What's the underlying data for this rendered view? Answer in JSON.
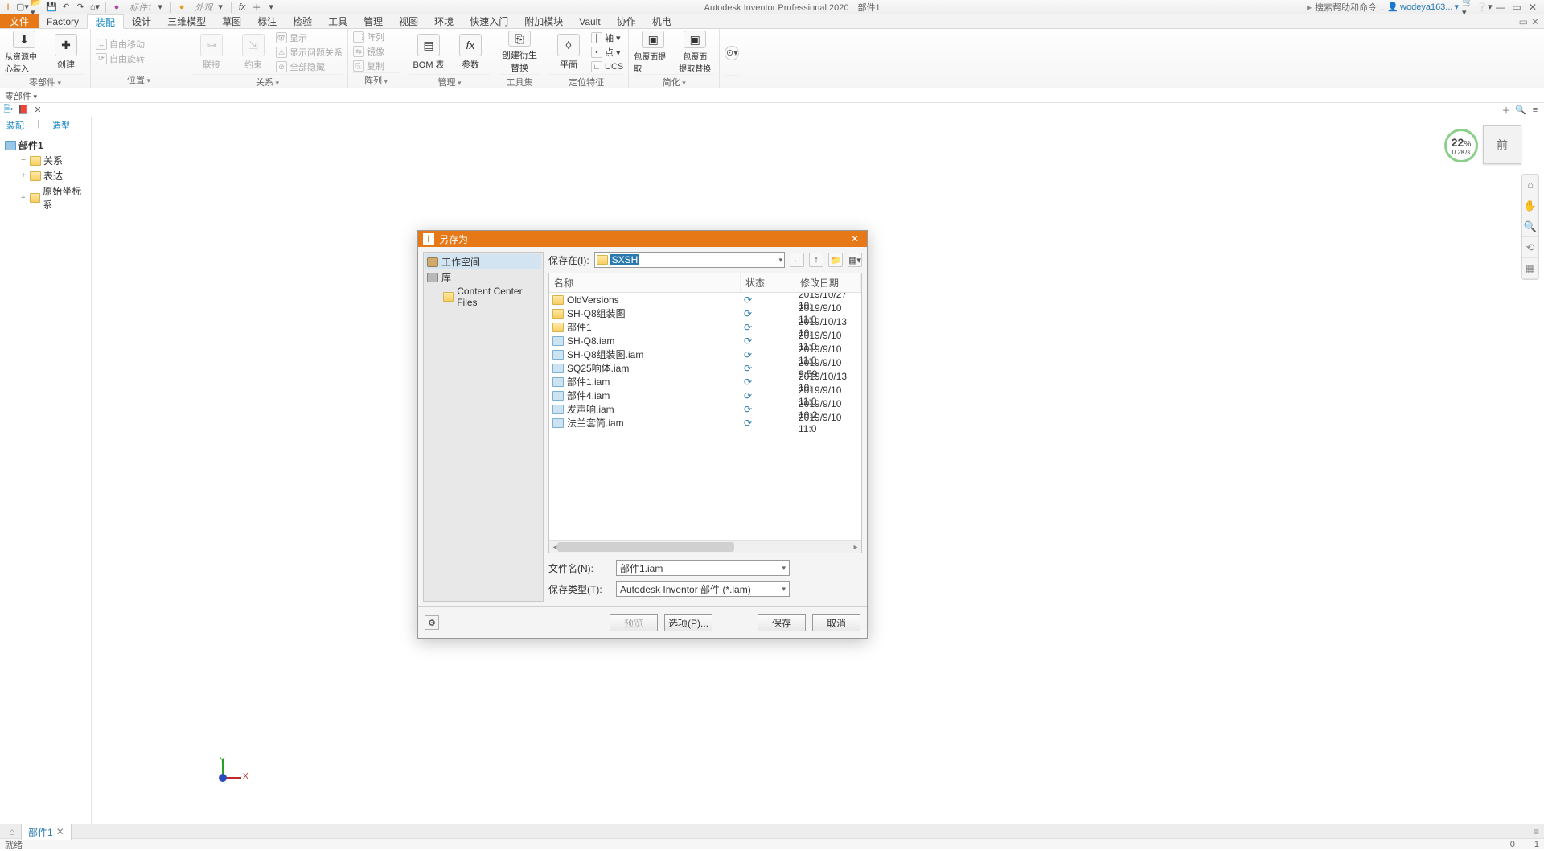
{
  "app": {
    "title_full": "Autodesk Inventor Professional 2020　部件1",
    "doc": "部件1"
  },
  "qat": {
    "search1": "标件1",
    "search2": "外观",
    "help_search": "搜索帮助和命令...",
    "user": "wodeya163..."
  },
  "tabs": {
    "file": "文件",
    "items": [
      "Factory",
      "装配",
      "设计",
      "三维模型",
      "草图",
      "标注",
      "检验",
      "工具",
      "管理",
      "视图",
      "环境",
      "快速入门",
      "附加模块",
      "Vault",
      "协作",
      "机电"
    ],
    "active_index": 1
  },
  "ribbon": {
    "panel1": {
      "btn1": "从资源中心装入",
      "btn2": "创建",
      "title": "零部件"
    },
    "panel2": {
      "row1": "自由移动",
      "row2": "自由旋转",
      "col2a": "联接",
      "col2b": "约束",
      "col3a": "显示",
      "col3b": "显示问题关系",
      "col3c": "全部隐藏",
      "title": "位置",
      "title2": "关系"
    },
    "panel3": {
      "r1": "阵列",
      "r2": "镜像",
      "r3": "复制",
      "title": "阵列"
    },
    "panel4": {
      "b1": "BOM 表",
      "b2": "参数",
      "title": "管理"
    },
    "panel5": {
      "b1": "创建衍生\n替换",
      "title": "工具集"
    },
    "panel6": {
      "b1": "平面",
      "r1": "轴",
      "r2": "点",
      "r3": "UCS",
      "title": "定位特征"
    },
    "panel7": {
      "b1": "包覆面提取",
      "b2": "包覆面\n提取替换",
      "title": "简化"
    }
  },
  "quick_panel": {
    "title": "零部件"
  },
  "browser": {
    "tabs": [
      "装配",
      "造型"
    ],
    "root": "部件1",
    "children": [
      "关系",
      "表达",
      "原始坐标系"
    ]
  },
  "viewcube": {
    "face": "前"
  },
  "ring": {
    "pct": "22",
    "unit": "%",
    "rate": "0.2K/s"
  },
  "nav_icons": [
    "⌂",
    "✋",
    "🔍",
    "⟲",
    "▦"
  ],
  "triad": {
    "x": "X",
    "y": "Y"
  },
  "doc_tab": {
    "name": "部件1"
  },
  "status": {
    "left": "就绪",
    "r1": "0",
    "r2": "1"
  },
  "dialog": {
    "title": "另存为",
    "left": {
      "workspace": "工作空间",
      "lib": "库",
      "ccf": "Content Center Files"
    },
    "save_in_label": "保存在(I):",
    "path_selected": "SXSH",
    "columns": {
      "name": "名称",
      "status": "状态",
      "date": "修改日期"
    },
    "files": [
      {
        "icon": "folder",
        "name": "OldVersions",
        "sync": true,
        "date": "2019/10/27 10:"
      },
      {
        "icon": "folder",
        "name": "SH-Q8组装图",
        "sync": true,
        "date": "2019/9/10 11:0"
      },
      {
        "icon": "folder",
        "name": "部件1",
        "sync": true,
        "date": "2019/10/13 10:"
      },
      {
        "icon": "iam",
        "name": "SH-Q8.iam",
        "sync": true,
        "date": "2019/9/10 11:0"
      },
      {
        "icon": "iam",
        "name": "SH-Q8组装图.iam",
        "sync": true,
        "date": "2019/9/10 11:0"
      },
      {
        "icon": "iam",
        "name": "SQ25响体.iam",
        "sync": true,
        "date": "2019/9/10 9:59"
      },
      {
        "icon": "iam",
        "name": "部件1.iam",
        "sync": true,
        "date": "2019/10/13 10:"
      },
      {
        "icon": "iam",
        "name": "部件4.iam",
        "sync": true,
        "date": "2019/9/10 11:0"
      },
      {
        "icon": "iam",
        "name": "发声响.iam",
        "sync": true,
        "date": "2019/9/10 10:2"
      },
      {
        "icon": "iam",
        "name": "法兰套筒.iam",
        "sync": true,
        "date": "2019/9/10 11:0"
      }
    ],
    "file_name_label": "文件名(N):",
    "file_name_value": "部件1.iam",
    "save_type_label": "保存类型(T):",
    "save_type_value": "Autodesk Inventor 部件 (*.iam)",
    "preview": "预览",
    "options": "选项(P)...",
    "save": "保存",
    "cancel": "取消"
  }
}
